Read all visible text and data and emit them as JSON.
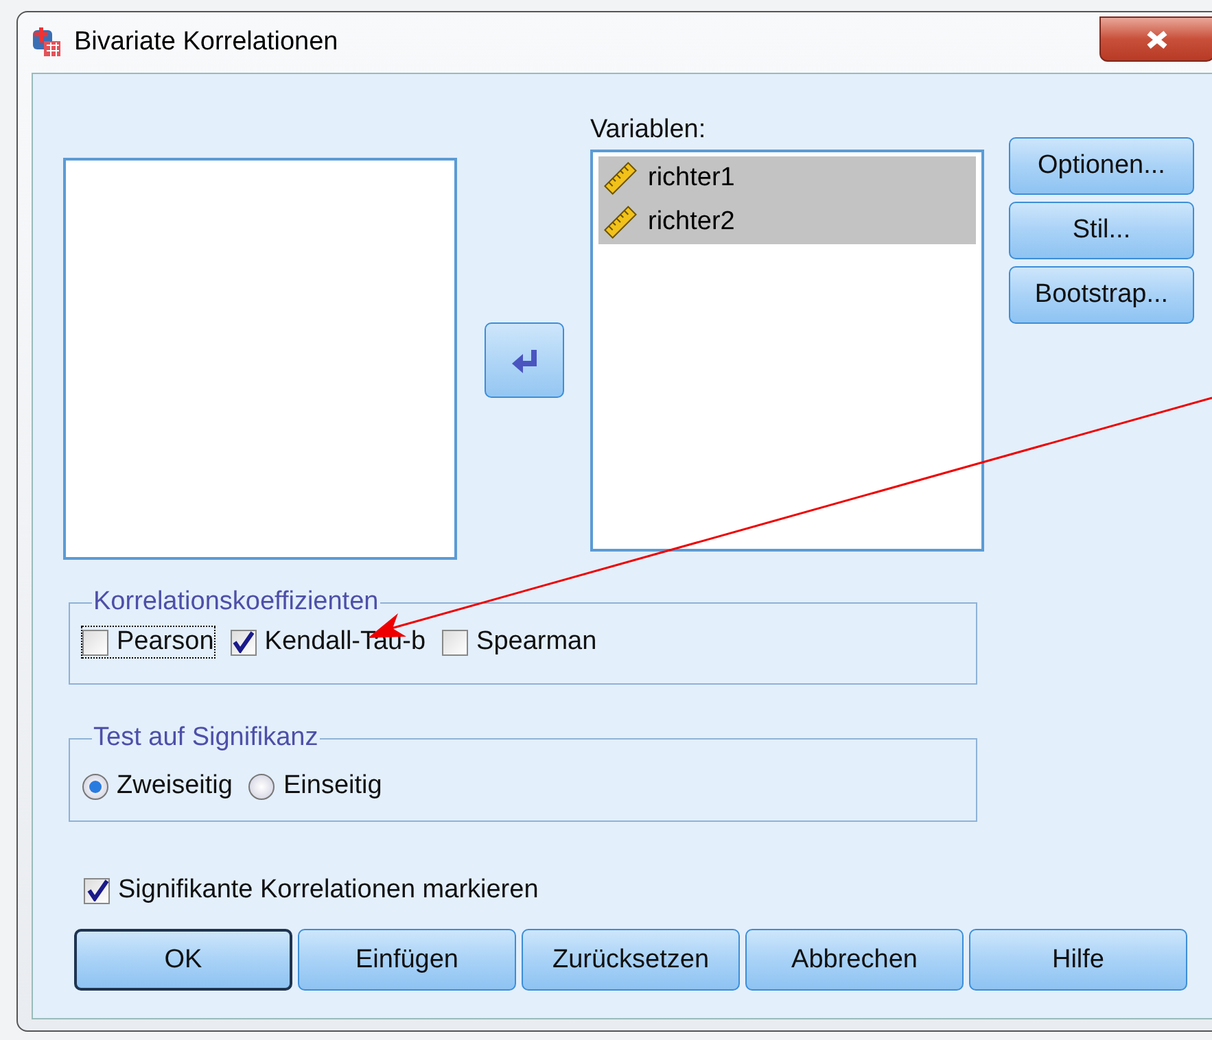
{
  "window": {
    "title": "Bivariate Korrelationen"
  },
  "target_list": {
    "label": "Variablen:",
    "items": [
      {
        "name": "richter1",
        "selected": true
      },
      {
        "name": "richter2",
        "selected": true
      }
    ]
  },
  "side_buttons": [
    "Optionen...",
    "Stil...",
    "Bootstrap..."
  ],
  "coefficients": {
    "title": "Korrelationskoeffizienten",
    "options": [
      {
        "label": "Pearson",
        "checked": false,
        "focused": true
      },
      {
        "label": "Kendall-Tau-b",
        "checked": true,
        "focused": false
      },
      {
        "label": "Spearman",
        "checked": false,
        "focused": false
      }
    ]
  },
  "significance": {
    "title": "Test auf Signifikanz",
    "options": [
      {
        "label": "Zweiseitig",
        "selected": true
      },
      {
        "label": "Einseitig",
        "selected": false
      }
    ]
  },
  "flag_significant": {
    "label": "Signifikante Korrelationen markieren",
    "checked": true
  },
  "buttons": [
    {
      "label": "OK",
      "default": true
    },
    {
      "label": "Einfügen",
      "default": false
    },
    {
      "label": "Zurücksetzen",
      "default": false
    },
    {
      "label": "Abbrechen",
      "default": false
    },
    {
      "label": "Hilfe",
      "default": false
    }
  ]
}
